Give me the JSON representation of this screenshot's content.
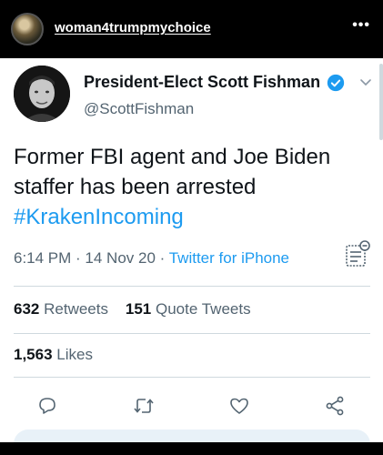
{
  "instagram": {
    "username": "woman4trumpmychoice",
    "more_icon": "•••"
  },
  "tweet": {
    "author_name": "President-Elect Scott Fishman",
    "author_handle": "@ScottFishman",
    "text_line": "Former FBI agent and Joe Biden staffer has been arrested",
    "hashtag": "#KrakenIncoming",
    "time": "6:14 PM",
    "date": "14 Nov 20",
    "source": "Twitter for iPhone",
    "separator": " · ",
    "retweets_count": "632",
    "retweets_label": "Retweets",
    "quotes_count": "151",
    "quotes_label": "Quote Tweets",
    "likes_count": "1,563",
    "likes_label": "Likes"
  },
  "colors": {
    "link_blue": "#1d9bf0",
    "secondary_text": "#536471",
    "verified_blue": "#1d9bf0"
  },
  "icons": [
    "more-icon",
    "verified-icon",
    "chevron-down-icon",
    "analytics-icon",
    "reply-icon",
    "retweet-icon",
    "like-icon",
    "share-icon"
  ]
}
